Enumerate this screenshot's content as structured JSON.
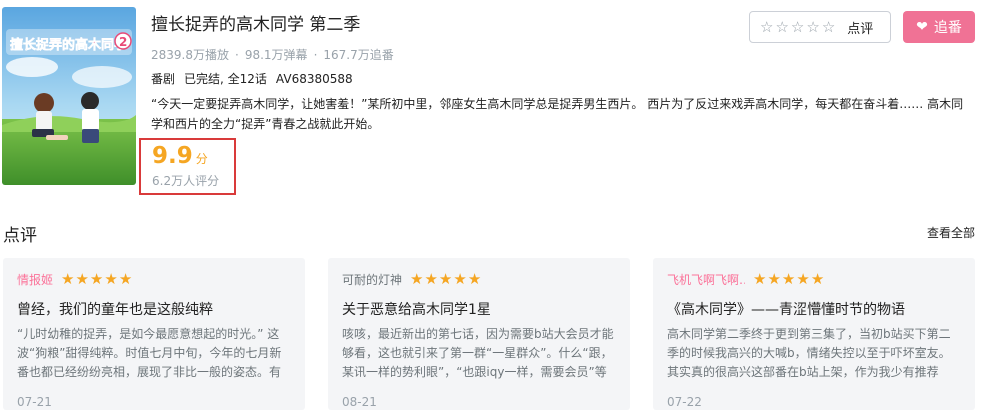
{
  "anime": {
    "title": "擅长捉弄的高木同学 第二季",
    "plays": "2839.8万播放",
    "danmaku": "98.1万弹幕",
    "followers": "167.7万追番",
    "type": "番剧",
    "status": "已完结, 全12话",
    "av": "AV68380588",
    "description": "“今天一定要捉弄高木同学，让她害羞！”某所初中里，邻座女生高木同学总是捉弄男生西片。 西片为了反过来戏弄高木同学，每天都在奋斗着…… 高木同学和西片的全力“捉弄”青春之战就此开始。",
    "cover_text": "擅长捉弄的高木同学",
    "cover_badge": "2"
  },
  "rating": {
    "score": "9.9",
    "unit": "分",
    "count": "6.2万人评分"
  },
  "actions": {
    "review_label": "点评",
    "follow_label": "追番",
    "review_stars": 0,
    "follow_color": "#f07295"
  },
  "reviews_section": {
    "title": "点评",
    "view_all": "查看全部"
  },
  "reviews": [
    {
      "user": "情报姬",
      "user_color": "pink",
      "stars": 5,
      "title": "曾经，我们的童年也是这般纯粹",
      "body": "“儿时幼稚的捉弄，是如今最愿意想起的时光。” 这波“狗粮”甜得纯粹。时值七月中旬，今年的七月新番也都已经纷纷亮相，展现了非比一般的姿态。有些热…",
      "date": "07-21"
    },
    {
      "user": "可耐的灯神",
      "user_color": "normal",
      "stars": 5,
      "title": "关于恶意给高木同学1星",
      "body": "咳咳，最近新出的第七话，因为需要b站大会员才能够看，这也就引来了第一群“一星群众”。什么“跟，某讯一样的势利眼”，“也跟iqy一样，需要会员”等等，…",
      "date": "08-21"
    },
    {
      "user": "飞机飞啊飞啊…",
      "user_color": "pink",
      "stars": 5,
      "title": "《高木同学》——青涩懵懂时节的物语",
      "body": "高木同学第二季终于更到第三集了，当初b站买下第二季的时候我高兴的大喊b，情绪失控以至于吓坏室友。其实真的很高兴这部番在b站上架，作为我少有推荐的…",
      "date": "07-22"
    }
  ],
  "colors": {
    "accent_orange": "#f5a623",
    "pink": "#fb7299",
    "highlight_border": "#d93a3a"
  }
}
